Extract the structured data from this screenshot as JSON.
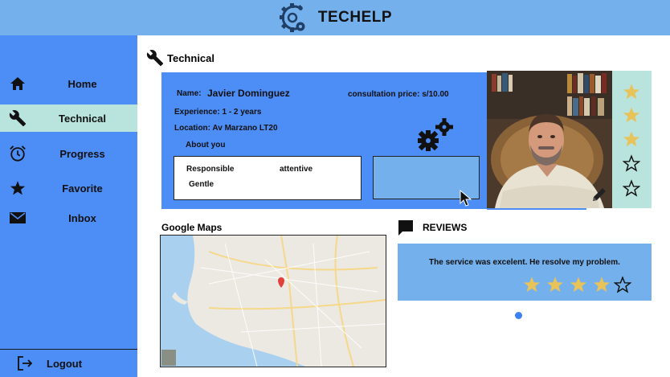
{
  "app": {
    "brand": "TECHELP",
    "accent": "#4d8df6",
    "header_color": "#74b0ec",
    "active_color": "#b9e3dd",
    "star_color": "#e7c35a"
  },
  "sidebar": {
    "items": [
      {
        "label": "Home",
        "icon": "home-icon"
      },
      {
        "label": "Technical",
        "icon": "wrench-icon",
        "active": true
      },
      {
        "label": "Progress",
        "icon": "alarm-clock-icon"
      },
      {
        "label": "Favorite",
        "icon": "star-icon"
      },
      {
        "label": "Inbox",
        "icon": "mail-icon"
      }
    ],
    "logout_label": "Logout"
  },
  "page": {
    "title": "Technical"
  },
  "profile": {
    "name_label": "Name:",
    "name": "Javier Dominguez",
    "price": "consultation price: s/10.00",
    "experience": "Experience: 1 - 2 years",
    "location": "Location: Av Marzano LT20",
    "about_label": "About you",
    "traits": [
      "Responsible",
      "attentive",
      "Gentle"
    ],
    "rating": 3,
    "rating_max": 5
  },
  "maps": {
    "title": "Google Maps"
  },
  "reviews": {
    "title": "REVIEWS",
    "items": [
      {
        "text": "The service was excelent. He resolve my problem.",
        "rating": 4,
        "rating_max": 5
      }
    ],
    "current_page": 1
  }
}
